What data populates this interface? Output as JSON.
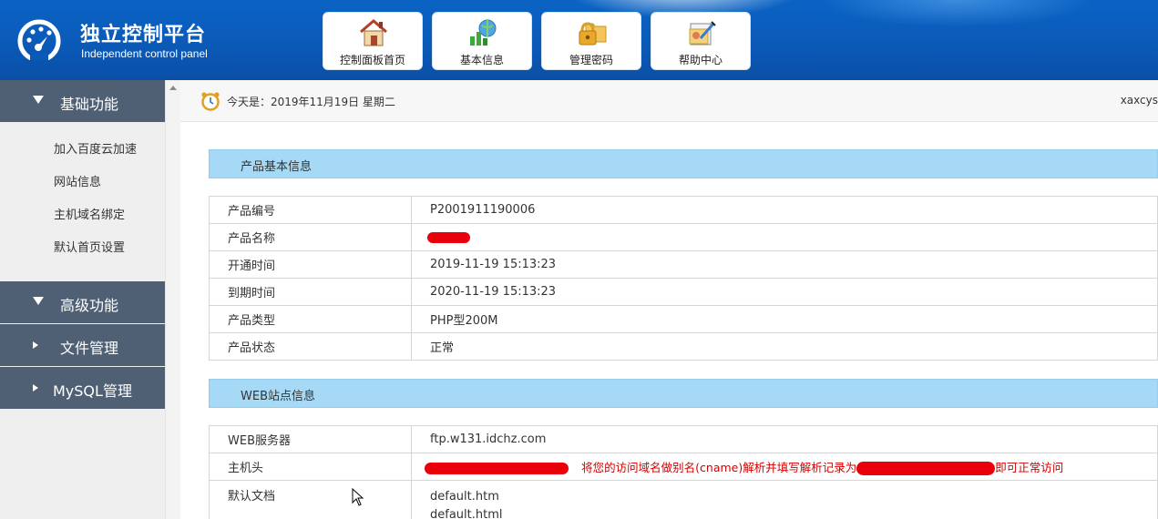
{
  "header": {
    "title": "独立控制平台",
    "subtitle": "Independent control panel",
    "nav": [
      {
        "label": "控制面板首页",
        "icon": "house-icon"
      },
      {
        "label": "基本信息",
        "icon": "chart-globe-icon"
      },
      {
        "label": "管理密码",
        "icon": "lock-folder-icon"
      },
      {
        "label": "帮助中心",
        "icon": "help-doc-icon"
      }
    ]
  },
  "sidebar": {
    "groups": [
      {
        "label": "基础功能",
        "expanded": true,
        "items": [
          "加入百度云加速",
          "网站信息",
          "主机域名绑定",
          "默认首页设置"
        ]
      },
      {
        "label": "高级功能",
        "expanded": true,
        "items": []
      },
      {
        "label": "文件管理",
        "expanded": false,
        "items": []
      },
      {
        "label": "MySQL管理",
        "expanded": false,
        "items": []
      }
    ]
  },
  "topbar": {
    "date_text": "今天是：2019年11月19日 星期二",
    "username": "xaxcys"
  },
  "product_section": {
    "title": "产品基本信息",
    "rows": [
      {
        "key": "产品编号",
        "value": "P2001911190006"
      },
      {
        "key": "产品名称",
        "value": ""
      },
      {
        "key": "开通时间",
        "value": "2019-11-19 15:13:23"
      },
      {
        "key": "到期时间",
        "value": "2020-11-19 15:13:23"
      },
      {
        "key": "产品类型",
        "value": "PHP型200M"
      },
      {
        "key": "产品状态",
        "value": "正常"
      }
    ]
  },
  "web_section": {
    "title": "WEB站点信息",
    "server_label": "WEB服务器",
    "server_value": "ftp.w131.idchz.com",
    "host_label": "主机头",
    "host_note_prefix": "将您的访问域名做别名(cname)解析并填写解析记录为",
    "host_note_suffix": "即可正常访问",
    "docs_label": "默认文档",
    "docs": [
      "default.htm",
      "default.html"
    ]
  },
  "colors": {
    "header_blue": "#0a5ab8",
    "sidebar_group": "#4f5f74",
    "section_bar": "#a6d9f5",
    "note_red": "#d20000"
  }
}
